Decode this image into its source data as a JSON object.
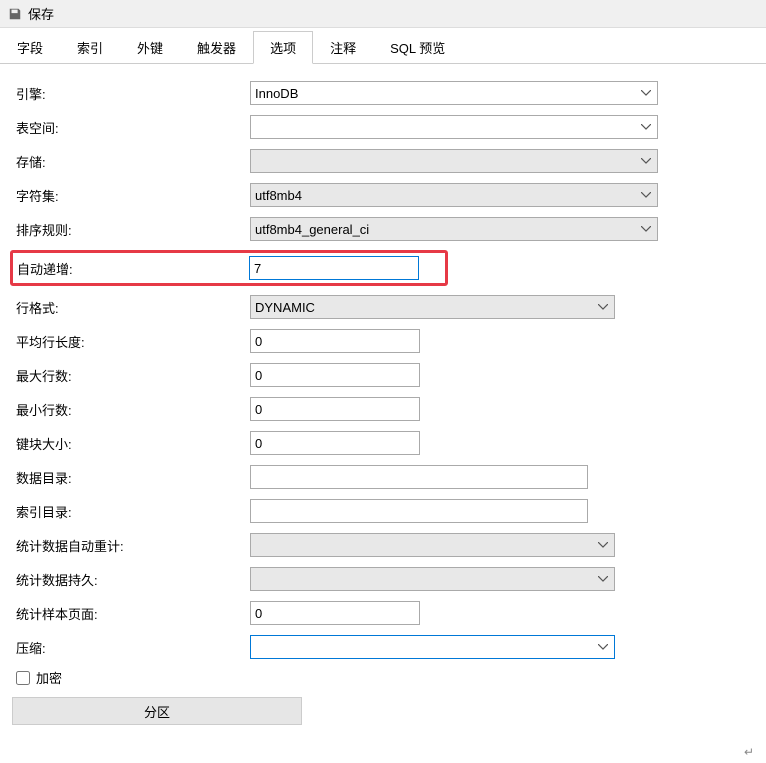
{
  "toolbar": {
    "save_label": "保存"
  },
  "tabs": {
    "fields": "字段",
    "indexes": "索引",
    "foreign_keys": "外键",
    "triggers": "触发器",
    "options": "选项",
    "comment": "注释",
    "sql_preview": "SQL 预览"
  },
  "form": {
    "engine": {
      "label": "引擎:",
      "value": "InnoDB"
    },
    "tablespace": {
      "label": "表空间:",
      "value": ""
    },
    "storage": {
      "label": "存储:",
      "value": ""
    },
    "charset": {
      "label": "字符集:",
      "value": "utf8mb4"
    },
    "collation": {
      "label": "排序规则:",
      "value": "utf8mb4_general_ci"
    },
    "auto_increment": {
      "label": "自动递增:",
      "value": "7"
    },
    "row_format": {
      "label": "行格式:",
      "value": "DYNAMIC"
    },
    "avg_row_length": {
      "label": "平均行长度:",
      "value": "0"
    },
    "max_rows": {
      "label": "最大行数:",
      "value": "0"
    },
    "min_rows": {
      "label": "最小行数:",
      "value": "0"
    },
    "key_block_size": {
      "label": "键块大小:",
      "value": "0"
    },
    "data_directory": {
      "label": "数据目录:",
      "value": ""
    },
    "index_directory": {
      "label": "索引目录:",
      "value": ""
    },
    "stats_auto_recalc": {
      "label": "统计数据自动重计:",
      "value": ""
    },
    "stats_persistent": {
      "label": "统计数据持久:",
      "value": ""
    },
    "stats_sample_pages": {
      "label": "统计样本页面:",
      "value": "0"
    },
    "compression": {
      "label": "压缩:",
      "value": ""
    },
    "encryption": {
      "label": "加密"
    },
    "partition_btn": "分区"
  },
  "footer_mark": "↵"
}
